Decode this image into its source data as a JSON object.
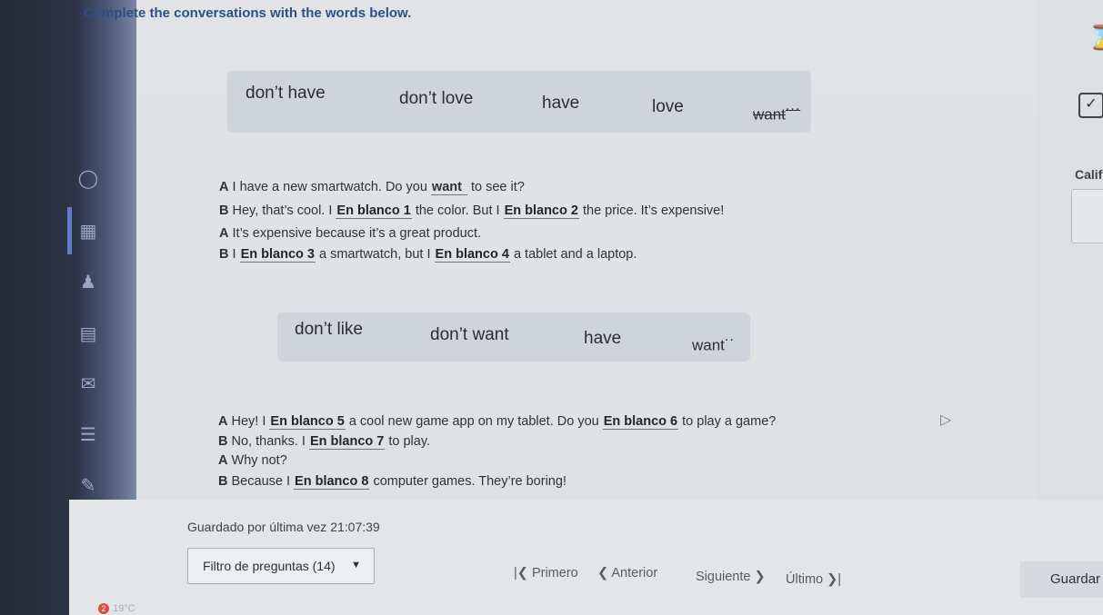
{
  "instruction": "Complete the conversations with the words below.",
  "word_bank_1": [
    "don’t have",
    "don’t love",
    "have",
    "love",
    "want"
  ],
  "word_bank_1_used": "want",
  "conversation_1": {
    "l1_speaker": "A",
    "l1_a": " I have a new smartwatch. Do you ",
    "l1_answer": "want",
    "l1_b": " to see it?",
    "l2_speaker": "B",
    "l2_a": " Hey, that’s cool. I ",
    "l2_blank1": "En blanco 1",
    "l2_b": " the color. But I ",
    "l2_blank2": "En blanco 2",
    "l2_c": " the price. It’s expensive!",
    "l3_speaker": "A",
    "l3_a": " It’s expensive because it’s a great product.",
    "l4_speaker": "B",
    "l4_a": " I ",
    "l4_blank3": "En blanco 3",
    "l4_b": " a smartwatch, but I ",
    "l4_blank4": "En blanco 4",
    "l4_c": " a tablet and a laptop."
  },
  "word_bank_2": [
    "don’t like",
    "don’t want",
    "have",
    "want"
  ],
  "conversation_2": {
    "l1_speaker": "A",
    "l1_a": " Hey! I ",
    "l1_blank5": "En blanco 5",
    "l1_b": " a cool new game app on my tablet. Do you ",
    "l1_blank6": "En blanco 6",
    "l1_c": " to play a game?",
    "l2_speaker": "B",
    "l2_a": " No, thanks. I ",
    "l2_blank7": "En blanco 7",
    "l2_b": " to play.",
    "l3_speaker": "A",
    "l3_a": " Why not?",
    "l4_speaker": "B",
    "l4_a": " Because I ",
    "l4_blank8": "En blanco 8",
    "l4_b": " computer games. They’re boring!"
  },
  "status": {
    "saved_label": "Guardado por última vez",
    "saved_time": "21:07:39"
  },
  "footer": {
    "filter_label": "Filtro de preguntas (14)",
    "first": "Primero",
    "previous": "Anterior",
    "next": "Siguiente",
    "last": "Último",
    "save": "Guardar"
  },
  "right_panel": {
    "grade_label": "Calif"
  },
  "weather": {
    "badge": "2",
    "temp": "19°C"
  },
  "colors": {
    "instruction": "#2e4f86",
    "sidebar": "#232a36",
    "word_bank_bg": "#cfd4da"
  }
}
